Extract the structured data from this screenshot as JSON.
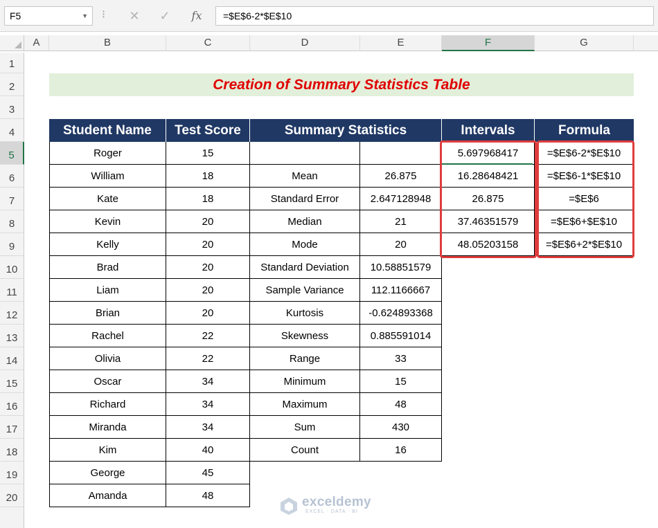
{
  "formula_bar": {
    "name_box": "F5",
    "cancel_icon": "✕",
    "enter_icon": "✓",
    "fx_label": "fx",
    "formula": "=$E$6-2*$E$10"
  },
  "columns": [
    "A",
    "B",
    "C",
    "D",
    "E",
    "F",
    "G"
  ],
  "selected_column": "F",
  "rows": [
    "1",
    "2",
    "3",
    "4",
    "5",
    "6",
    "7",
    "8",
    "9",
    "10",
    "11",
    "12",
    "13",
    "14",
    "15",
    "16",
    "17",
    "18",
    "19",
    "20"
  ],
  "selected_row": "5",
  "title": "Creation of Summary Statistics Table",
  "headers": {
    "student_name": "Student Name",
    "test_score": "Test Score",
    "summary_statistics": "Summary Statistics",
    "intervals": "Intervals",
    "formula": "Formula"
  },
  "students": [
    {
      "name": "Roger",
      "score": "15"
    },
    {
      "name": "William",
      "score": "18"
    },
    {
      "name": "Kate",
      "score": "18"
    },
    {
      "name": "Kevin",
      "score": "20"
    },
    {
      "name": "Kelly",
      "score": "20"
    },
    {
      "name": "Brad",
      "score": "20"
    },
    {
      "name": "Liam",
      "score": "20"
    },
    {
      "name": "Brian",
      "score": "20"
    },
    {
      "name": "Rachel",
      "score": "22"
    },
    {
      "name": "Olivia",
      "score": "22"
    },
    {
      "name": "Oscar",
      "score": "34"
    },
    {
      "name": "Richard",
      "score": "34"
    },
    {
      "name": "Miranda",
      "score": "34"
    },
    {
      "name": "Kim",
      "score": "40"
    },
    {
      "name": "George",
      "score": "45"
    },
    {
      "name": "Amanda",
      "score": "48"
    }
  ],
  "summary": [
    {
      "label": "",
      "value": ""
    },
    {
      "label": "Mean",
      "value": "26.875"
    },
    {
      "label": "Standard Error",
      "value": "2.647128948"
    },
    {
      "label": "Median",
      "value": "21"
    },
    {
      "label": "Mode",
      "value": "20"
    },
    {
      "label": "Standard Deviation",
      "value": "10.58851579"
    },
    {
      "label": "Sample Variance",
      "value": "112.1166667"
    },
    {
      "label": "Kurtosis",
      "value": "-0.624893368"
    },
    {
      "label": "Skewness",
      "value": "0.885591014"
    },
    {
      "label": "Range",
      "value": "33"
    },
    {
      "label": "Minimum",
      "value": "15"
    },
    {
      "label": "Maximum",
      "value": "48"
    },
    {
      "label": "Sum",
      "value": "430"
    },
    {
      "label": "Count",
      "value": "16"
    }
  ],
  "intervals": [
    {
      "value": "5.697968417",
      "formula": "=$E$6-2*$E$10"
    },
    {
      "value": "16.28648421",
      "formula": "=$E$6-1*$E$10"
    },
    {
      "value": "26.875",
      "formula": "=$E$6"
    },
    {
      "value": "37.46351579",
      "formula": "=$E$6+$E$10"
    },
    {
      "value": "48.05203158",
      "formula": "=$E$6+2*$E$10"
    }
  ],
  "watermark": {
    "name": "exceldemy",
    "tagline": "EXCEL · DATA · BI"
  },
  "colors": {
    "header_bg": "#203864",
    "title_band": "#e2efda",
    "title_text": "#e00000",
    "highlight_box": "#e03c3c",
    "selection": "#217346"
  }
}
